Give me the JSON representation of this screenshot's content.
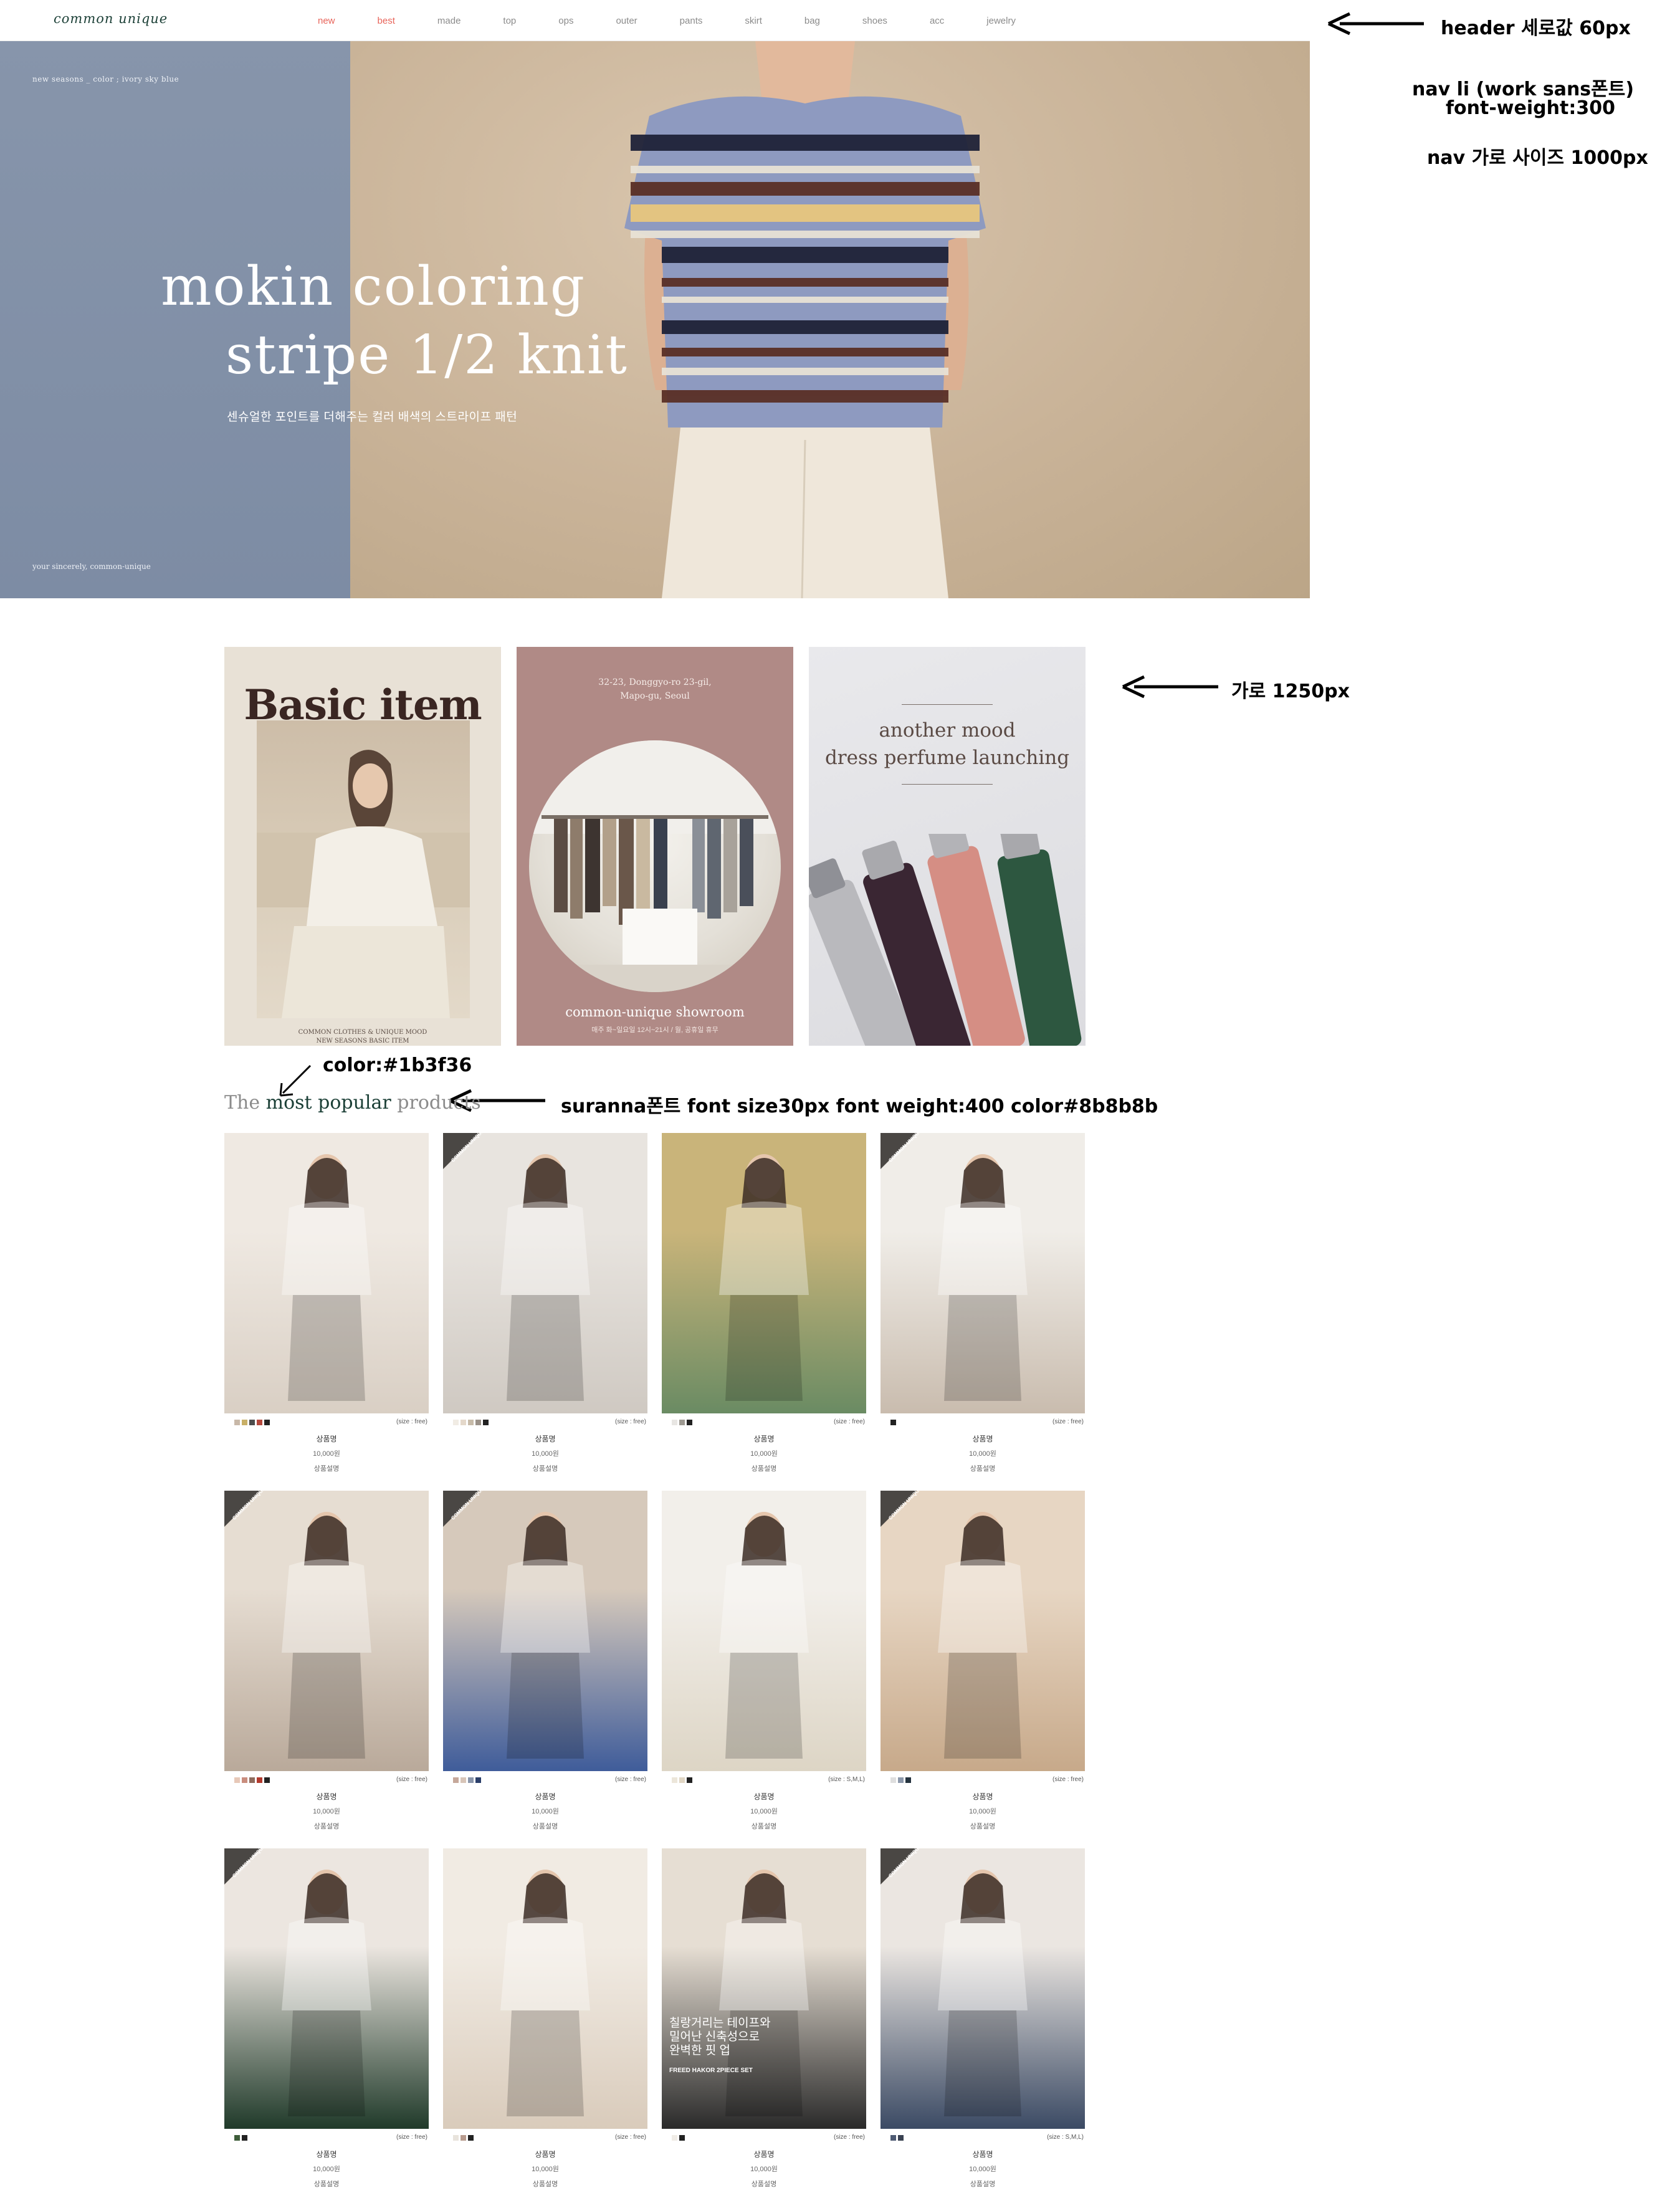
{
  "header": {
    "logo": "common unique",
    "nav": [
      "new",
      "best",
      "made",
      "top",
      "ops",
      "outer",
      "pants",
      "skirt",
      "bag",
      "shoes",
      "acc",
      "jewelry"
    ]
  },
  "hero": {
    "top_caption": "new seasons _ color ; ivory  sky blue",
    "title_line1": "mokin coloring",
    "title_line2": "stripe 1/2 knit",
    "subtitle": "센슈얼한 포인트를 더해주는 컬러 배색의 스트라이프 패턴",
    "bottom_caption": "your sincerely, common-unique"
  },
  "annotations": {
    "header_height": "header 세로값 60px",
    "nav_font_1": "nav li (work sans폰트)",
    "nav_font_2": "font-weight:300",
    "nav_width": "nav 가로 사이즈 1000px",
    "banner_width": "가로 1250px",
    "accent_color": "color:#1b3f36",
    "section_font": "suranna폰트 font size30px font weight:400 color#8b8b8b"
  },
  "banners": {
    "basic": {
      "title": "Basic item",
      "caption_line1": "COMMON CLOTHES & UNIQUE MOOD",
      "caption_line2": "NEW SEASONS BASIC ITEM"
    },
    "showroom": {
      "address_line1": "32-23, Donggyo-ro 23-gil,",
      "address_line2": "Mapo-gu, Seoul",
      "title": "common-unique showroom",
      "hours": "매주 화~일요일 12시~21시 / 월, 공휴일 휴무"
    },
    "perfume": {
      "title_line1": "another mood",
      "title_line2": "dress perfume launching"
    }
  },
  "section": {
    "title_pre": "The ",
    "title_accent": "most popular",
    "title_post": " products"
  },
  "badge_text": "COMMON UNIQUE",
  "products": [
    {
      "name": "상품명",
      "price": "10,000원",
      "desc": "상품설명",
      "size": "(size : free)",
      "badge": false,
      "swatches": [
        "#c8b8a8",
        "#c9b067",
        "#4d4d4d",
        "#b5483c",
        "#222222"
      ],
      "bg": [
        "#efe9e2",
        "#d9cfc4"
      ]
    },
    {
      "name": "상품명",
      "price": "10,000원",
      "desc": "상품설명",
      "size": "(size : free)",
      "badge": true,
      "swatches": [
        "#f1ece4",
        "#e4d8ca",
        "#c7bba9",
        "#9a9188",
        "#222222"
      ],
      "bg": [
        "#e8e4df",
        "#cfc9c2"
      ]
    },
    {
      "name": "상품명",
      "price": "10,000원",
      "desc": "상품설명",
      "size": "(size : free)",
      "badge": false,
      "swatches": [
        "#e8e6e3",
        "#9e9a92",
        "#222222"
      ],
      "bg": [
        "#c9b47a",
        "#6a8b63"
      ]
    },
    {
      "name": "상품명",
      "price": "10,000원",
      "desc": "상품설명",
      "size": "(size : free)",
      "badge": true,
      "swatches": [
        "#222222"
      ],
      "bg": [
        "#f0ede8",
        "#c9bcae"
      ]
    },
    {
      "name": "상품명",
      "price": "10,000원",
      "desc": "상품설명",
      "size": "(size : free)",
      "badge": true,
      "swatches": [
        "#e7c8b8",
        "#c98d7e",
        "#8f6b5d",
        "#b33a2e",
        "#222222"
      ],
      "bg": [
        "#e6ddd2",
        "#b9a99a"
      ]
    },
    {
      "name": "상품명",
      "price": "10,000원",
      "desc": "상품설명",
      "size": "(size : free)",
      "badge": true,
      "swatches": [
        "#c6a89a",
        "#d8c5b8",
        "#8a96ab",
        "#2b3f6a"
      ],
      "bg": [
        "#d6c9bb",
        "#3f5c9a"
      ]
    },
    {
      "name": "상품명",
      "price": "10,000원",
      "desc": "상품설명",
      "size": "(size : S,M,L)",
      "badge": false,
      "swatches": [
        "#ece6da",
        "#e0d6c4",
        "#222222"
      ],
      "bg": [
        "#f2efea",
        "#ddd5c5"
      ]
    },
    {
      "name": "상품명",
      "price": "10,000원",
      "desc": "상품설명",
      "size": "(size : free)",
      "badge": true,
      "swatches": [
        "#dedede",
        "#8c98ab",
        "#25333f"
      ],
      "bg": [
        "#e7d6c3",
        "#c7a98a"
      ]
    },
    {
      "name": "상품명",
      "price": "10,000원",
      "desc": "상품설명",
      "size": "(size : free)",
      "badge": true,
      "swatches": [
        "#3e5d3a",
        "#222222"
      ],
      "bg": [
        "#ece6e0",
        "#203a2a"
      ]
    },
    {
      "name": "상품명",
      "price": "10,000원",
      "desc": "상품설명",
      "size": "(size : free)",
      "badge": false,
      "swatches": [
        "#e8e3dc",
        "#b89b8e",
        "#222222"
      ],
      "bg": [
        "#f1ebe3",
        "#d9cbbb"
      ]
    },
    {
      "name": "상품명",
      "price": "10,000원",
      "desc": "상품설명",
      "size": "(size : free)",
      "badge": false,
      "swatches": [
        "#f0ece6",
        "#222222"
      ],
      "bg": [
        "#e6ded3",
        "#2a2a2a"
      ]
    },
    {
      "name": "상품명",
      "price": "10,000원",
      "desc": "상품설명",
      "size": "(size : S,M,L)",
      "badge": true,
      "swatches": [
        "#4e5b73",
        "#3a4252"
      ],
      "bg": [
        "#ebe6e1",
        "#3b4a64"
      ]
    }
  ],
  "product7_overlay": {
    "line1": "칠랑거리는 테이프와",
    "line2": "밀어난 신축성으로",
    "line3": "완벽한 핏 업",
    "line4": "FREED HAKOR 2PIECE SET"
  },
  "colors": {
    "accent": "#1b3f36",
    "muted": "#8b8b8b",
    "nav_highlight": "#e8645a"
  }
}
